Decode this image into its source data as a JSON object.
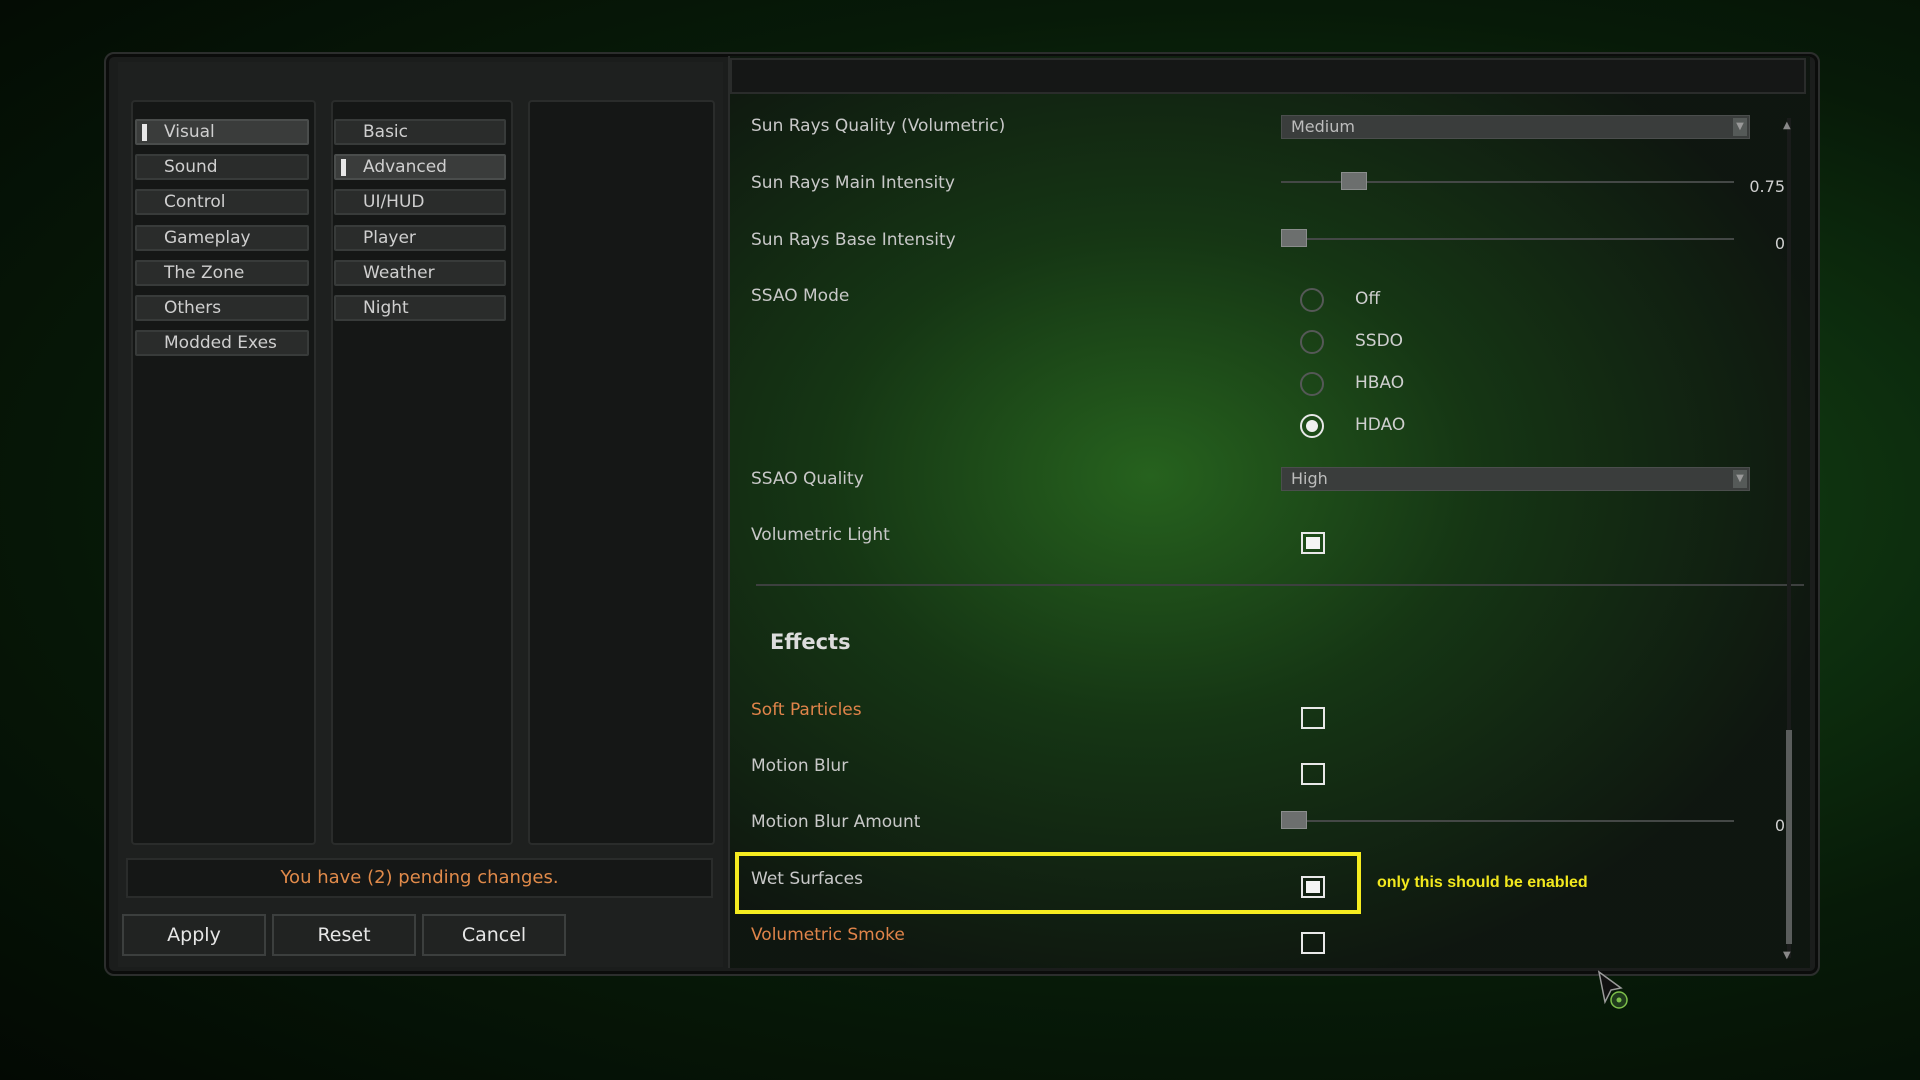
{
  "categories": [
    "Visual",
    "Sound",
    "Control",
    "Gameplay",
    "The Zone",
    "Others",
    "Modded Exes"
  ],
  "active_category": "Visual",
  "subcategories": [
    "Basic",
    "Advanced",
    "UI/HUD",
    "Player",
    "Weather",
    "Night"
  ],
  "active_subcategory": "Advanced",
  "pending_message": "You have (2) pending changes.",
  "buttons": {
    "apply": "Apply",
    "reset": "Reset",
    "cancel": "Cancel"
  },
  "settings": {
    "sun_rays_quality": {
      "label": "Sun Rays Quality (Volumetric)",
      "value": "Medium"
    },
    "sun_rays_main_intensity": {
      "label": "Sun Rays Main Intensity",
      "value": "0.75",
      "fraction": 0.14
    },
    "sun_rays_base_intensity": {
      "label": "Sun Rays Base Intensity",
      "value": "0",
      "fraction": 0.0
    },
    "ssao_mode": {
      "label": "SSAO Mode",
      "options": [
        "Off",
        "SSDO",
        "HBAO",
        "HDAO"
      ],
      "selected": "HDAO"
    },
    "ssao_quality": {
      "label": "SSAO Quality",
      "value": "High"
    },
    "volumetric_light": {
      "label": "Volumetric Light",
      "checked": true
    },
    "effects_header": "Effects",
    "soft_particles": {
      "label": "Soft Particles",
      "checked": false
    },
    "motion_blur": {
      "label": "Motion Blur",
      "checked": false
    },
    "motion_blur_amount": {
      "label": "Motion Blur Amount",
      "value": "0",
      "fraction": 0.0
    },
    "wet_surfaces": {
      "label": "Wet Surfaces",
      "checked": true
    },
    "volumetric_smoke": {
      "label": "Volumetric Smoke",
      "checked": false
    }
  },
  "annotation": "only this should be enabled",
  "colors": {
    "accent_orange": "#e0844a",
    "highlight_yellow": "#f5ec20"
  }
}
